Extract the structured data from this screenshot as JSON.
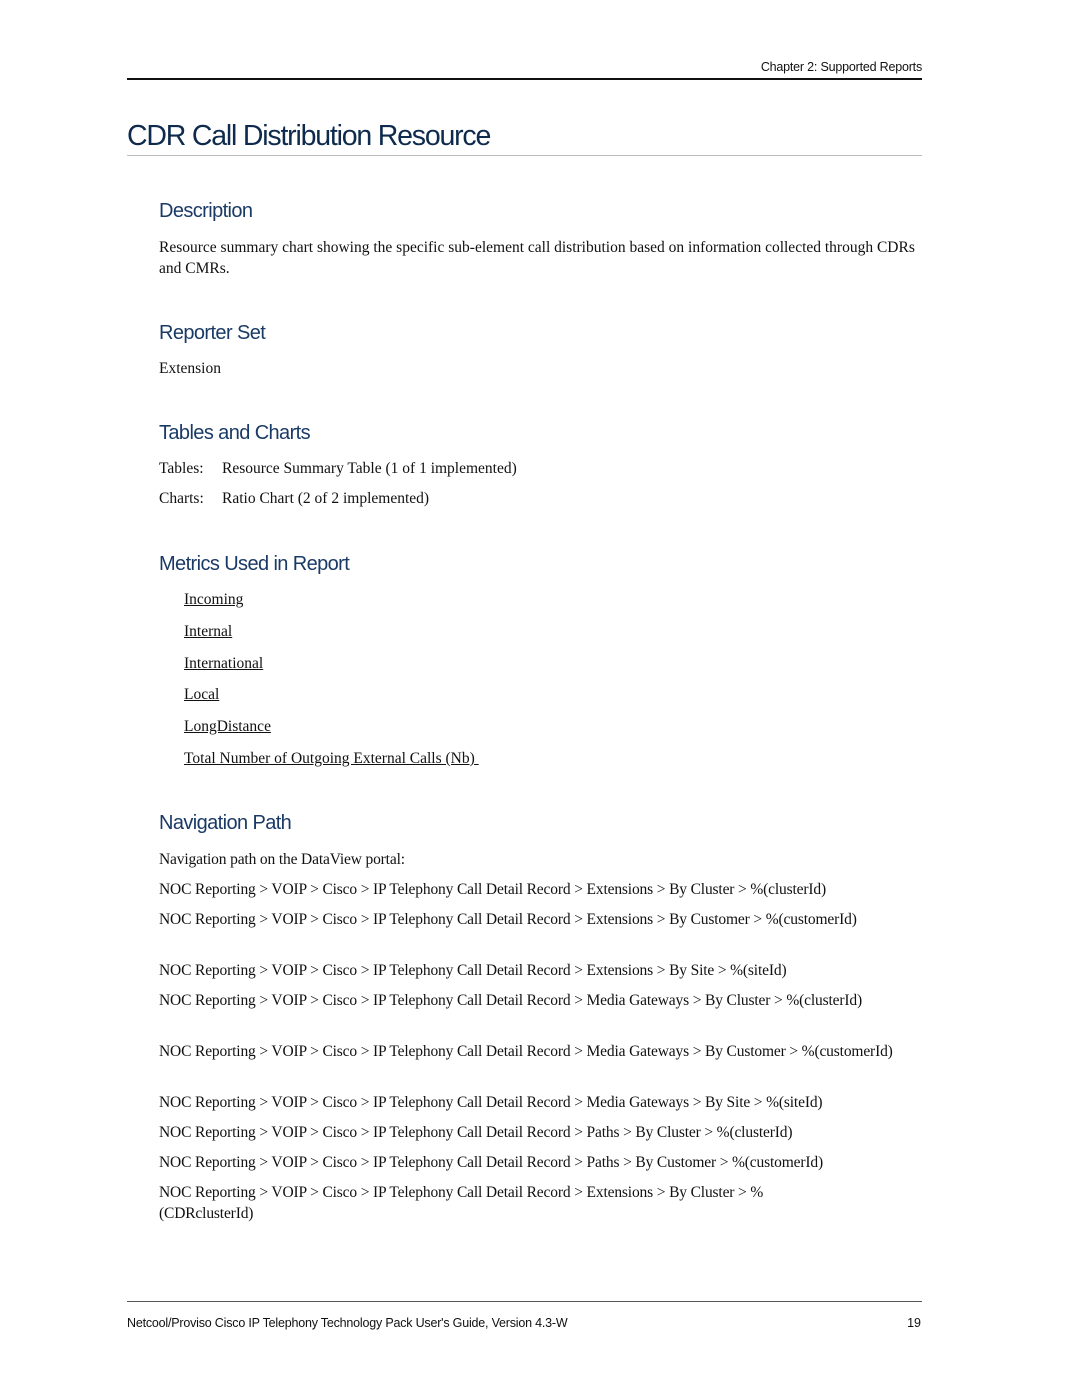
{
  "header": {
    "running_head": "Chapter 2: Supported Reports"
  },
  "page_title": "CDR Call Distribution Resource",
  "sections": {
    "description": {
      "heading": "Description",
      "text": "Resource summary chart showing the specific sub-element call distribution based on information collected through CDRs and CMRs."
    },
    "reporter_set": {
      "heading": "Reporter Set",
      "text": "Extension"
    },
    "tables_and_charts": {
      "heading": "Tables and Charts",
      "rows": [
        {
          "label": "Tables:",
          "value": "Resource Summary Table (1 of 1 implemented)"
        },
        {
          "label": "Charts:",
          "value": "Ratio Chart (2 of 2 implemented)"
        }
      ]
    },
    "metrics": {
      "heading": "Metrics Used in Report",
      "items": [
        "Incoming",
        "Internal",
        "International",
        "Local",
        "LongDistance",
        "Total Number of Outgoing External Calls (Nb) "
      ]
    },
    "navigation": {
      "heading": "Navigation Path",
      "intro": "Navigation path on the DataView portal:",
      "paths": [
        "NOC Reporting > VOIP > Cisco > IP Telephony Call Detail Record > Extensions > By Cluster > %(clusterId)",
        "NOC Reporting > VOIP > Cisco > IP Telephony Call Detail Record > Extensions > By Customer > %(customerId)",
        "NOC Reporting > VOIP > Cisco > IP Telephony Call Detail Record > Extensions > By Site > %(siteId)",
        "NOC Reporting > VOIP > Cisco > IP Telephony Call Detail Record > Media Gateways > By Cluster > %(clusterId)",
        "NOC Reporting > VOIP > Cisco > IP Telephony Call Detail Record > Media Gateways > By Customer > %(customerId)",
        "NOC Reporting > VOIP > Cisco > IP Telephony Call Detail Record > Media Gateways > By Site > %(siteId)",
        "NOC Reporting > VOIP > Cisco > IP Telephony Call Detail Record > Paths > By Cluster > %(clusterId)",
        "NOC Reporting > VOIP > Cisco > IP Telephony Call Detail Record > Paths > By Customer > %(customerId)",
        "NOC Reporting > VOIP > Cisco > IP Telephony Call Detail Record > Extensions > By Cluster > %(CDRclusterId)"
      ]
    }
  },
  "footer": {
    "text": "Netcool/Proviso Cisco IP Telephony Technology Pack User's Guide, Version 4.3-W",
    "page_number": "19"
  }
}
